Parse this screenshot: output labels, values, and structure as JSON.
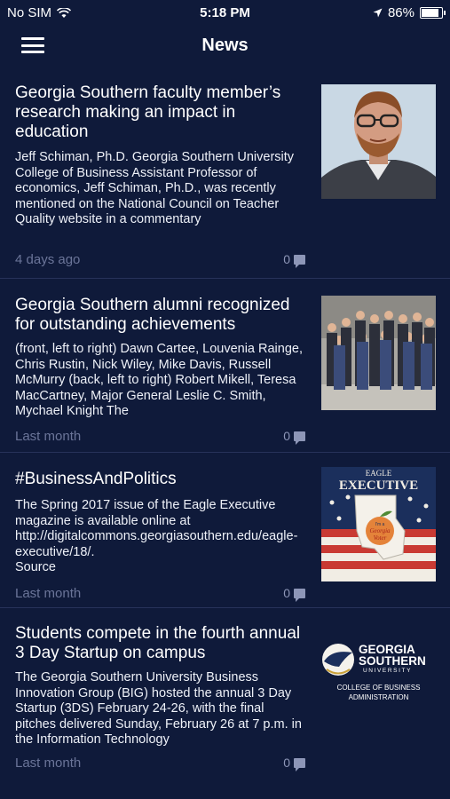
{
  "status": {
    "carrier": "No SIM",
    "time": "5:18 PM",
    "battery": "86%",
    "battery_level": 0.86
  },
  "header": {
    "title": "News"
  },
  "items": [
    {
      "title": "Georgia Southern faculty member’s research making an impact in education",
      "summary": "Jeff Schiman, Ph.D. Georgia Southern University College of Business Assistant Professor of economics, Jeff Schiman, Ph.D., was recently mentioned on the National Council on Teacher Quality website in a commentary",
      "time": "4 days ago",
      "comments": "0"
    },
    {
      "title": "Georgia Southern alumni recognized for outstanding achievements",
      "summary": "(front, left to right) Dawn Cartee, Louvenia Rainge, Chris Rustin, Nick Wiley, Mike Davis, Russell McMurry (back, left to right) Robert Mikell, Teresa MacCartney, Major General Leslie C. Smith, Mychael Knight The",
      "time": "Last month",
      "comments": "0"
    },
    {
      "title": "#BusinessAndPolitics",
      "summary": "The Spring 2017 issue of the Eagle Executive magazine is available online at http://digitalcommons.georgiasouthern.edu/eagle-executive/18/.\n Source",
      "time": "Last month",
      "comments": "0",
      "thumb_text": {
        "top": "EAGLE",
        "main": "EXECUTIVE",
        "sticker1": "I'm a",
        "sticker2": "Georgia",
        "sticker3": "Voter"
      }
    },
    {
      "title": "Students compete in the fourth annual 3 Day Startup on campus",
      "summary": "The Georgia Southern University Business Innovation Group (BIG) hosted the annual 3 Day Startup (3DS) February 24-26, with the final pitches delivered Sunday, February 26 at 7 p.m. in the Information Technology",
      "time": "Last month",
      "comments": "0",
      "logo": {
        "line1": "GEORGIA",
        "line2": "SOUTHERN",
        "line3": "UNIVERSITY",
        "sub1": "COLLEGE OF BUSINESS",
        "sub2": "ADMINISTRATION"
      }
    }
  ]
}
